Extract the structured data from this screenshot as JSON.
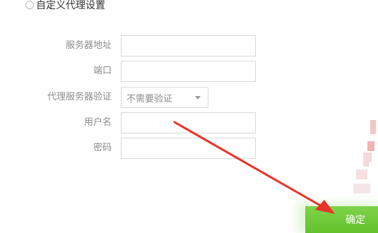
{
  "proxy": {
    "custom_option_label": "自定义代理设置",
    "fields": {
      "server_label": "服务器地址",
      "server_value": "",
      "port_label": "端口",
      "port_value": "",
      "auth_label": "代理服务器验证",
      "auth_selected": "不需要验证",
      "username_label": "用户名",
      "username_value": "",
      "password_label": "密码",
      "password_value": ""
    },
    "confirm_label": "确定"
  },
  "colors": {
    "annotation_arrow": "#e8332a",
    "confirm_button": "#6cc836"
  }
}
